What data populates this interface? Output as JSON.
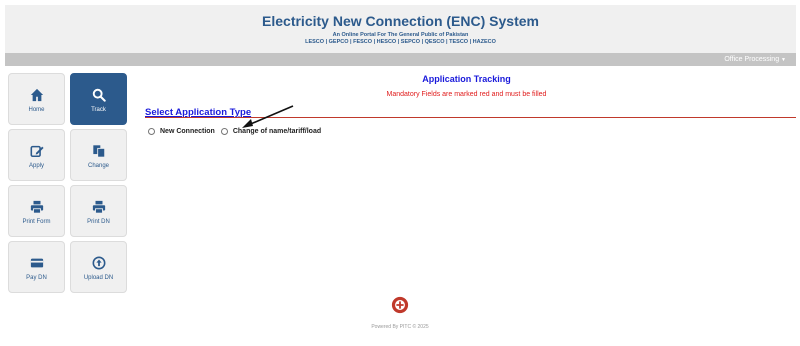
{
  "header": {
    "title": "Electricity New Connection (ENC) System",
    "subtitle": "An Online Portal For The General Public of Pakistan",
    "companies": "LESCO | GEPCO | FESCO | HESCO | SEPCO | QESCO | TESCO | HAZECO"
  },
  "menubar": {
    "office_label": "Office Processing"
  },
  "sidebar": {
    "items": [
      {
        "label": "Home",
        "icon": "home-icon",
        "active": false
      },
      {
        "label": "Track",
        "icon": "search-icon",
        "active": true
      },
      {
        "label": "Apply",
        "icon": "edit-icon",
        "active": false
      },
      {
        "label": "Change",
        "icon": "copy-icon",
        "active": false
      },
      {
        "label": "Print Form",
        "icon": "print-icon",
        "active": false
      },
      {
        "label": "Print DN",
        "icon": "print-icon",
        "active": false
      },
      {
        "label": "Pay DN",
        "icon": "credit-card-icon",
        "active": false
      },
      {
        "label": "Upload DN",
        "icon": "upload-icon",
        "active": false
      }
    ]
  },
  "main": {
    "title": "Application Tracking",
    "mandatory_note": "Mandatory Fields are marked red and must be filled",
    "section_title": "Select Application Type",
    "options": [
      {
        "label": "New Connection",
        "checked": false
      },
      {
        "label": "Change of name/tariff/load",
        "checked": false
      }
    ]
  },
  "footer": {
    "powered_by": "Powered By PITC © 2025"
  },
  "colors": {
    "brand_blue": "#2c5a8c",
    "link_blue": "#1a1adb",
    "required_red": "#e01b1b"
  }
}
